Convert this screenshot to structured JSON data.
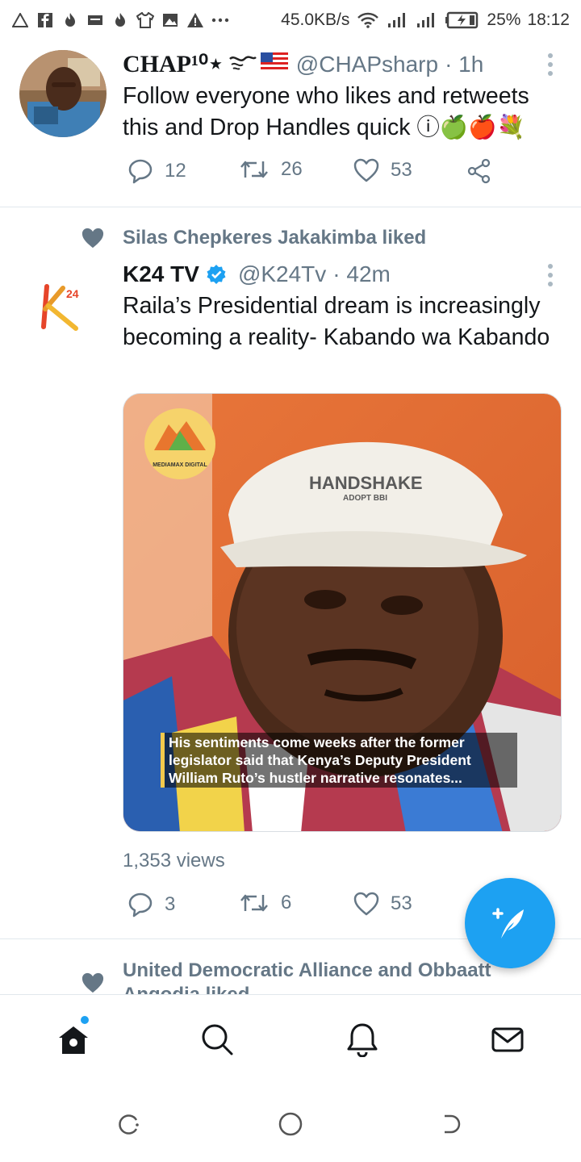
{
  "status_bar": {
    "net_speed": "45.0KB/s",
    "battery": "25%",
    "time": "18:12",
    "icons": [
      "warning-outline-icon",
      "facebook-icon",
      "flame-icon",
      "message-icon",
      "flame-icon",
      "shirt-icon",
      "gallery-icon",
      "warning-icon",
      "more-icon",
      "wifi-icon",
      "signal-icon",
      "signal-icon",
      "battery-icon"
    ]
  },
  "tweets": [
    {
      "name": "CHAP¹⁰⋆",
      "handle": "@CHAPsharp",
      "time": "· 1h",
      "text": "Follow everyone who likes and retweets this and Drop Handles quick ⓘ🍏🍎💐",
      "replies": "12",
      "retweets": "26",
      "likes": "53"
    },
    {
      "context": "Silas Chepkeres Jakakimba liked",
      "name": "K24 TV",
      "handle": "@K24Tv",
      "time": "· 42m",
      "text": "Raila’s Presidential dream is increasingly becoming a reality- Kabando wa Kabando",
      "media": {
        "logo_text": "MEDIAMAX DIGITAL",
        "cap_text": "HANDSHAKE",
        "cap_subtext": "ADOPT BBI",
        "caption": "His sentiments come weeks after the former legislator said that Kenya’s Deputy President William Ruto’s hustler narrative resonates..."
      },
      "views": "1,353 views",
      "replies": "3",
      "retweets": "6",
      "likes": "53"
    },
    {
      "context": "United Democratic Alliance and Obbaatt Angodia liked"
    }
  ],
  "colors": {
    "accent": "#1da1f2",
    "secondary_text": "#657786",
    "verified": "#1da1f2"
  }
}
